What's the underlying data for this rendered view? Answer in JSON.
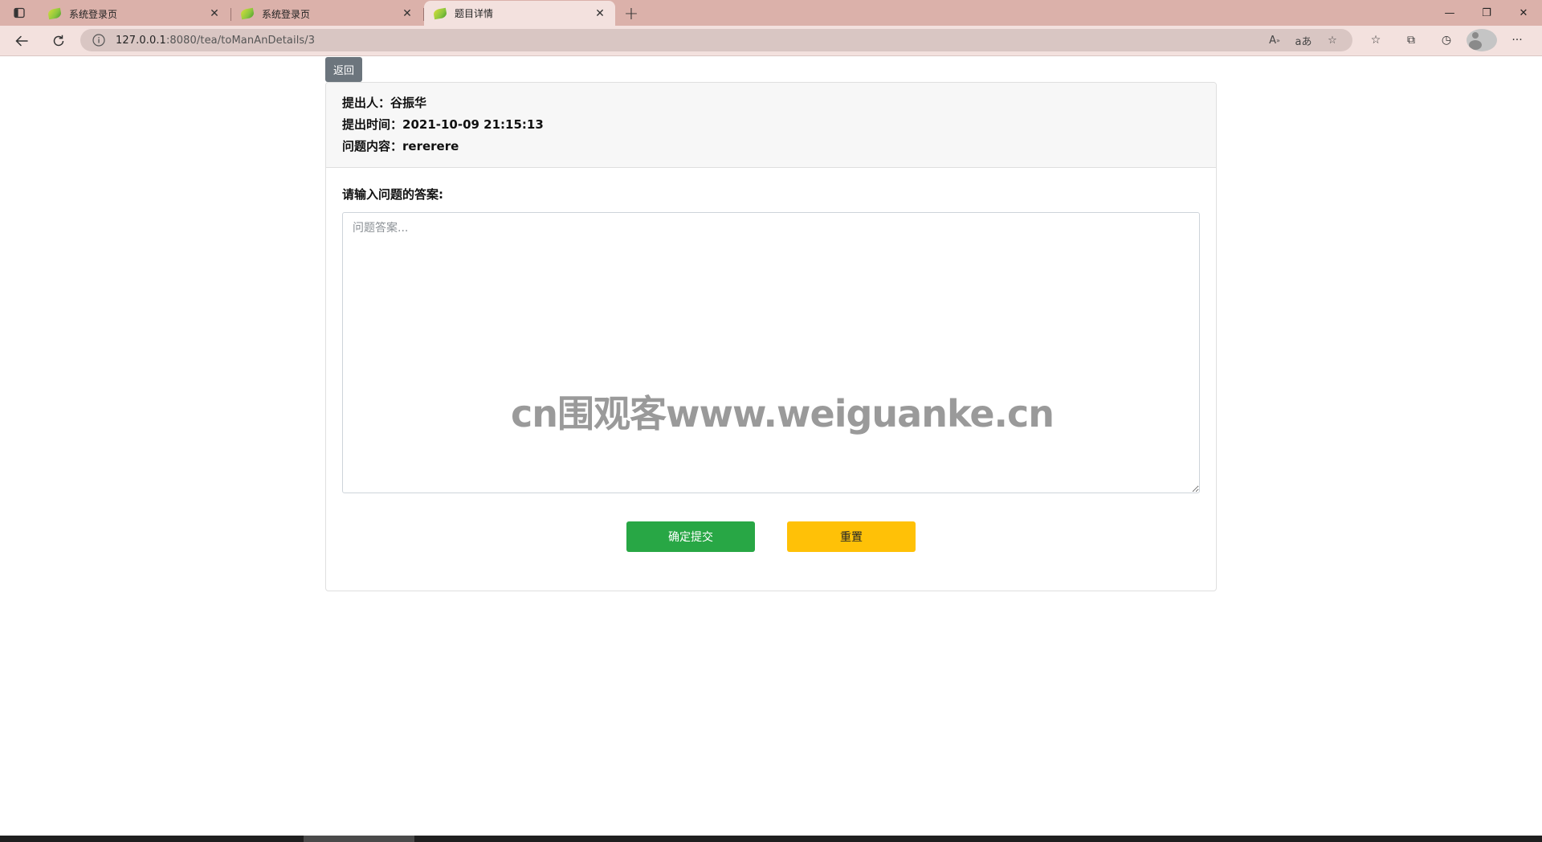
{
  "browser": {
    "tabs": [
      {
        "title": "系统登录页",
        "active": false
      },
      {
        "title": "系统登录页",
        "active": false
      },
      {
        "title": "题目详情",
        "active": true
      }
    ],
    "new_tab_label": "+",
    "url_host": "127.0.0.1",
    "url_path": ":8080/tea/toManAnDetails/3",
    "window_controls": {
      "minimize": "—",
      "restore": "❐",
      "close": "✕"
    }
  },
  "page": {
    "back_label": "返回",
    "question": {
      "submitter_label": "提出人：",
      "submitter": "谷振华",
      "time_label": "提出时间：",
      "time": "2021-10-09 21:15:13",
      "content_label": "问题内容：",
      "content": "rererere"
    },
    "answer_label": "请输入问题的答案:",
    "answer_placeholder": "问题答案...",
    "submit_label": "确定提交",
    "reset_label": "重置",
    "watermark": "cn围观客www.weiguanke.cn"
  },
  "colors": {
    "tabbar": "#dbb1aa",
    "toolbar": "#f3e1de",
    "back_button": "#6c757d",
    "submit_button": "#28a745",
    "reset_button": "#ffc107"
  },
  "icons": [
    "sidebar-icon",
    "leaf-favicon-icon",
    "close-icon",
    "back-arrow-icon",
    "refresh-icon",
    "info-icon",
    "read-aloud-icon",
    "translate-icon",
    "add-favorite-icon",
    "favorites-icon",
    "collections-icon",
    "history-icon",
    "profile-icon",
    "more-icon"
  ]
}
